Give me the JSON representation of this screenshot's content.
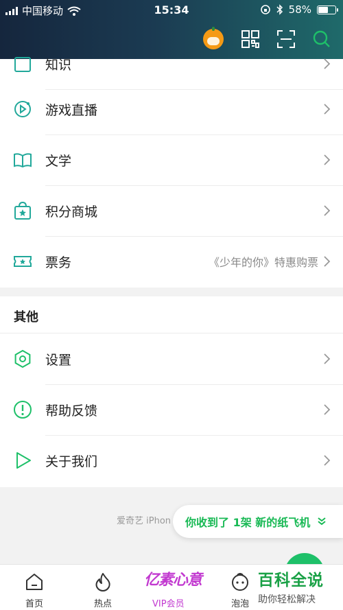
{
  "status_bar": {
    "carrier": "中国移动",
    "time": "15:34",
    "battery": "58%",
    "battery_level": 0.58
  },
  "header": {
    "icons": [
      "avatar",
      "qr-code-icon",
      "scan-icon",
      "search-icon"
    ]
  },
  "menu": {
    "partial_item": "知识",
    "items": [
      {
        "label": "游戏直播",
        "icon": "game-live-icon"
      },
      {
        "label": "文学",
        "icon": "book-icon"
      },
      {
        "label": "积分商城",
        "icon": "points-mall-icon"
      },
      {
        "label": "票务",
        "icon": "ticket-icon",
        "extra": "《少年的你》特惠购票"
      }
    ]
  },
  "other": {
    "title": "其他",
    "items": [
      {
        "label": "设置",
        "icon": "settings-icon"
      },
      {
        "label": "帮助反馈",
        "icon": "help-icon"
      },
      {
        "label": "关于我们",
        "icon": "about-icon"
      }
    ]
  },
  "footer": {
    "version_text": "爱奇艺 iPhon",
    "toast": "你收到了 1架 新的纸飞机"
  },
  "tabbar": {
    "items": [
      {
        "label": "首页",
        "icon": "home-icon"
      },
      {
        "label": "热点",
        "icon": "flame-icon"
      },
      {
        "label": "VIP会员",
        "logo": "亿素心意"
      },
      {
        "label": "泡泡",
        "icon": "bubble-icon"
      }
    ]
  },
  "watermark": {
    "title": "百科全说",
    "subtitle": "助你轻松解决"
  },
  "colors": {
    "accent": "#1ec069",
    "icon": "#21a89a",
    "vip": "#c23ad0"
  }
}
